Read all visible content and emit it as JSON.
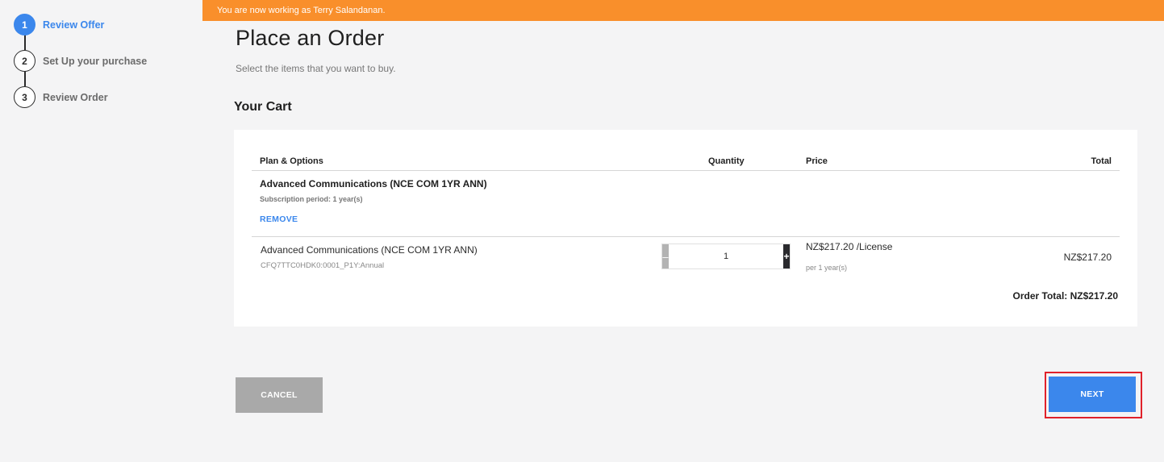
{
  "stepper": {
    "steps": [
      {
        "number": "1",
        "label": "Review Offer",
        "active": true
      },
      {
        "number": "2",
        "label": "Set Up your purchase",
        "active": false
      },
      {
        "number": "3",
        "label": "Review Order",
        "active": false
      }
    ]
  },
  "banner": {
    "text": "You are now working as Terry Salandanan."
  },
  "page": {
    "title": "Place an Order",
    "subtitle": "Select the items that you want to buy."
  },
  "cart": {
    "heading": "Your Cart",
    "columns": {
      "plan": "Plan & Options",
      "quantity": "Quantity",
      "price": "Price",
      "total": "Total"
    },
    "plan": {
      "title": "Advanced Communications (NCE COM 1YR ANN)",
      "period": "Subscription period: 1 year(s)",
      "remove_label": "REMOVE"
    },
    "item": {
      "name": "Advanced Communications (NCE COM 1YR ANN)",
      "sku": "CFQ7TTC0HDK0:0001_P1Y:Annual",
      "quantity": "1",
      "minus": "–",
      "plus": "+",
      "price": "NZ$217.20 /License",
      "price_period": "per 1 year(s)",
      "total": "NZ$217.20"
    },
    "order_total": "Order Total: NZ$217.20"
  },
  "actions": {
    "cancel_label": "CANCEL",
    "next_label": "NEXT"
  },
  "colors": {
    "accent": "#3b87ec",
    "banner": "#f98f2b",
    "highlight": "#e0212a"
  }
}
